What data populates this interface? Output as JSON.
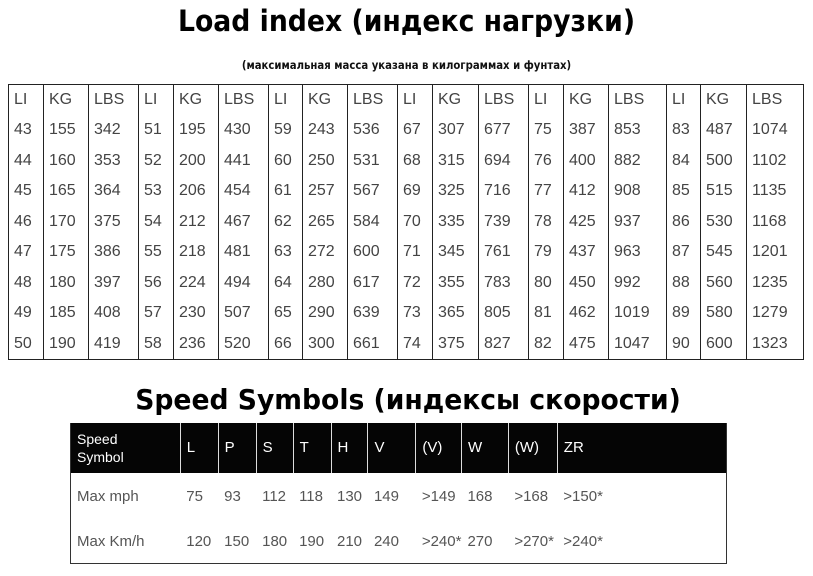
{
  "load_index": {
    "title": "Load index (индекс нагрузки)",
    "subtitle": "(максимальная масса указана в килограммах и фунтах)",
    "headers": [
      "LI",
      "KG",
      "LBS",
      "LI",
      "KG",
      "LBS",
      "LI",
      "KG",
      "LBS",
      "LI",
      "KG",
      "LBS",
      "LI",
      "KG",
      "LBS",
      "LI",
      "KG",
      "LBS"
    ],
    "rows": [
      [
        "43",
        "155",
        "342",
        "51",
        "195",
        "430",
        "59",
        "243",
        "536",
        "67",
        "307",
        "677",
        "75",
        "387",
        "853",
        "83",
        "487",
        "1074"
      ],
      [
        "44",
        "160",
        "353",
        "52",
        "200",
        "441",
        "60",
        "250",
        "531",
        "68",
        "315",
        "694",
        "76",
        "400",
        "882",
        "84",
        "500",
        "1102"
      ],
      [
        "45",
        "165",
        "364",
        "53",
        "206",
        "454",
        "61",
        "257",
        "567",
        "69",
        "325",
        "716",
        "77",
        "412",
        "908",
        "85",
        "515",
        "1135"
      ],
      [
        "46",
        "170",
        "375",
        "54",
        "212",
        "467",
        "62",
        "265",
        "584",
        "70",
        "335",
        "739",
        "78",
        "425",
        "937",
        "86",
        "530",
        "1168"
      ],
      [
        "47",
        "175",
        "386",
        "55",
        "218",
        "481",
        "63",
        "272",
        "600",
        "71",
        "345",
        "761",
        "79",
        "437",
        "963",
        "87",
        "545",
        "1201"
      ],
      [
        "48",
        "180",
        "397",
        "56",
        "224",
        "494",
        "64",
        "280",
        "617",
        "72",
        "355",
        "783",
        "80",
        "450",
        "992",
        "88",
        "560",
        "1235"
      ],
      [
        "49",
        "185",
        "408",
        "57",
        "230",
        "507",
        "65",
        "290",
        "639",
        "73",
        "365",
        "805",
        "81",
        "462",
        "1019",
        "89",
        "580",
        "1279"
      ],
      [
        "50",
        "190",
        "419",
        "58",
        "236",
        "520",
        "66",
        "300",
        "661",
        "74",
        "375",
        "827",
        "82",
        "475",
        "1047",
        "90",
        "600",
        "1323"
      ]
    ]
  },
  "speed_symbols": {
    "title": "Speed Symbols  (индексы скорости)",
    "header_label_line1": "Speed",
    "header_label_line2": "Symbol",
    "symbols": [
      "L",
      "P",
      "S",
      "T",
      "H",
      "V",
      "(V)",
      "W",
      "(W)",
      "ZR"
    ],
    "rows": [
      {
        "label": "Max mph",
        "values": [
          "75",
          "93",
          "112",
          "118",
          "130",
          "149",
          ">149",
          "168",
          ">168",
          ">150*"
        ]
      },
      {
        "label": "Max Km/h",
        "values": [
          "120",
          "150",
          "180",
          "190",
          "210",
          "240",
          ">240*",
          "270",
          ">270*",
          ">240*"
        ]
      }
    ]
  }
}
